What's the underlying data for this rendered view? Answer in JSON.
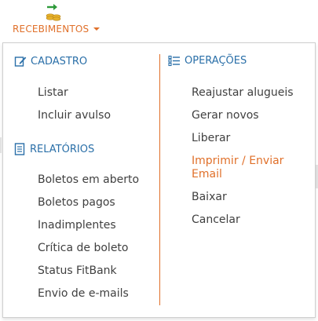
{
  "nav": {
    "label": "RECEBIMENTOS",
    "icon": "money-transfer-icon"
  },
  "columns": [
    {
      "sections": [
        {
          "title": "CADASTRO",
          "icon": "edit-icon",
          "items": [
            "Listar",
            "Incluir avulso"
          ]
        },
        {
          "title": "RELATÓRIOS",
          "icon": "report-icon",
          "items": [
            "Boletos em aberto",
            "Boletos pagos",
            "Inadimplentes",
            "Crítica de boleto",
            "Status FitBank",
            "Envio de e-mails"
          ]
        }
      ]
    },
    {
      "sections": [
        {
          "title": "OPERAÇÕES",
          "icon": "list-icon",
          "items": [
            "Reajustar alugueis",
            "Gerar novos",
            "Liberar",
            "Imprimir / Enviar Email",
            "Baixar",
            "Cancelar"
          ]
        }
      ]
    }
  ],
  "colors": {
    "accent": "#e0702a",
    "section_heading": "#2a6fa8",
    "item_text": "#404040",
    "icon_green": "#2e9a3a",
    "icon_gold": "#e8b22a"
  }
}
